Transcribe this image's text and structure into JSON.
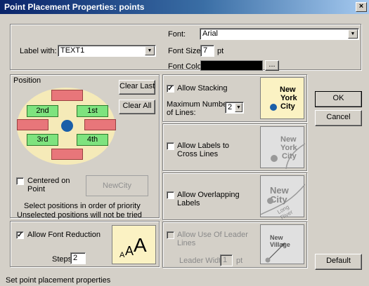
{
  "window": {
    "title": "Point Placement Properties: points",
    "close_glyph": "×"
  },
  "label_with": {
    "label": "Label with:",
    "value": "TEXT1"
  },
  "font": {
    "font_label": "Font:",
    "font_value": "Arial",
    "size_label": "Font Size:",
    "size_value": "7",
    "size_unit": "pt",
    "color_label": "Font Color:",
    "color_value": "#000000",
    "color_button": "..."
  },
  "position": {
    "group_label": "Position",
    "clear_last": "Clear Last",
    "clear_all": "Clear All",
    "slot_1st": "1st",
    "slot_2nd": "2nd",
    "slot_3rd": "3rd",
    "slot_4th": "4th",
    "centered_label": "Centered on Point",
    "centered_checked": false,
    "centered_preview": "NewCity",
    "hint_1": "Select positions in order of priority",
    "hint_2": "Unselected positions will not be tried"
  },
  "font_reduction": {
    "label": "Allow Font Reduction",
    "checked": true,
    "steps_label": "Steps",
    "steps_value": "2",
    "preview_glyphs": [
      "A",
      "A",
      "A"
    ]
  },
  "stacking": {
    "label": "Allow Stacking",
    "checked": true,
    "max_lines_label_1": "Maximum Number",
    "max_lines_label_2": "of Lines:",
    "max_lines_value": "2",
    "preview": [
      "New",
      "York",
      "City"
    ]
  },
  "cross_lines": {
    "label_1": "Allow Labels to",
    "label_2": "Cross Lines",
    "checked": false,
    "preview": [
      "New",
      "York",
      "City"
    ]
  },
  "overlapping": {
    "label_1": "Allow Overlapping",
    "label_2": "Labels",
    "checked": false,
    "preview": [
      "New",
      "City",
      "Long River"
    ]
  },
  "leader": {
    "label_1": "Allow Use Of Leader",
    "label_2": "Lines",
    "checked": false,
    "width_label": "Leader Width",
    "width_value": "1",
    "width_unit": "pt",
    "preview": "New Village"
  },
  "buttons": {
    "ok": "OK",
    "cancel": "Cancel",
    "default": "Default"
  },
  "status": "Set point placement properties",
  "colors": {
    "red_slot": "#e8767a",
    "green_slot": "#7ee37e",
    "ellipse": "#f5eab8",
    "center_dot": "#1a5fa8"
  }
}
